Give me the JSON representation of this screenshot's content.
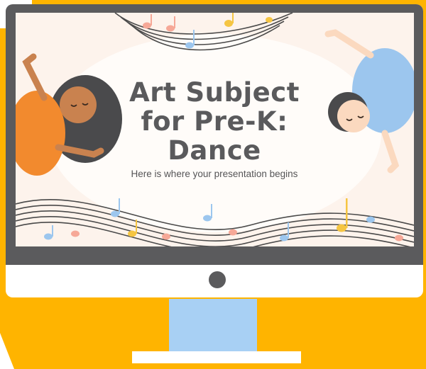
{
  "slide": {
    "title_lines": [
      "Art Subject",
      "for Pre-K:",
      "Dance"
    ],
    "subtitle": "Here is where your presentation begins"
  },
  "colors": {
    "frame_yellow": "#ffb400",
    "bezel": "#5b5b5d",
    "screen_bg": "#fdf3ec",
    "stand": "#a8d0f4",
    "title_text": "#5a5a5c"
  },
  "icons": [
    "music-note-icon",
    "power-button-icon"
  ]
}
